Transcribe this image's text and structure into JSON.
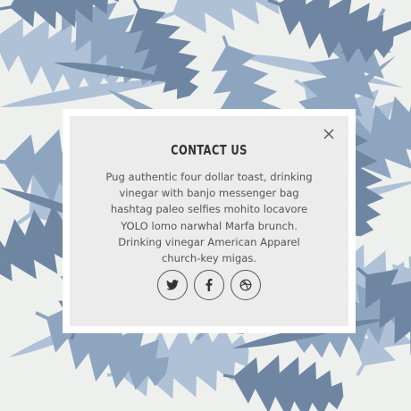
{
  "modal": {
    "title": "CONTACT US",
    "body_lines": [
      "Pug authentic four dollar toast, drinking",
      "vinegar with banjo messenger bag",
      "hashtag paleo selfies mohito locavore",
      "YOLO lomo narwhal Marfa brunch.",
      "Drinking vinegar American Apparel",
      "church-key migas."
    ],
    "close_icon": "close-icon",
    "socials": [
      {
        "name": "twitter-icon"
      },
      {
        "name": "facebook-icon"
      },
      {
        "name": "dribbble-icon"
      }
    ]
  },
  "colors": {
    "background": "#eef0ee",
    "leaf_dark": "#6f86a3",
    "leaf_mid": "#8ea5c0",
    "leaf_light": "#aec1d6",
    "modal_bg": "#ececec",
    "modal_border": "#ffffff",
    "text": "#555555",
    "title": "#333333"
  }
}
